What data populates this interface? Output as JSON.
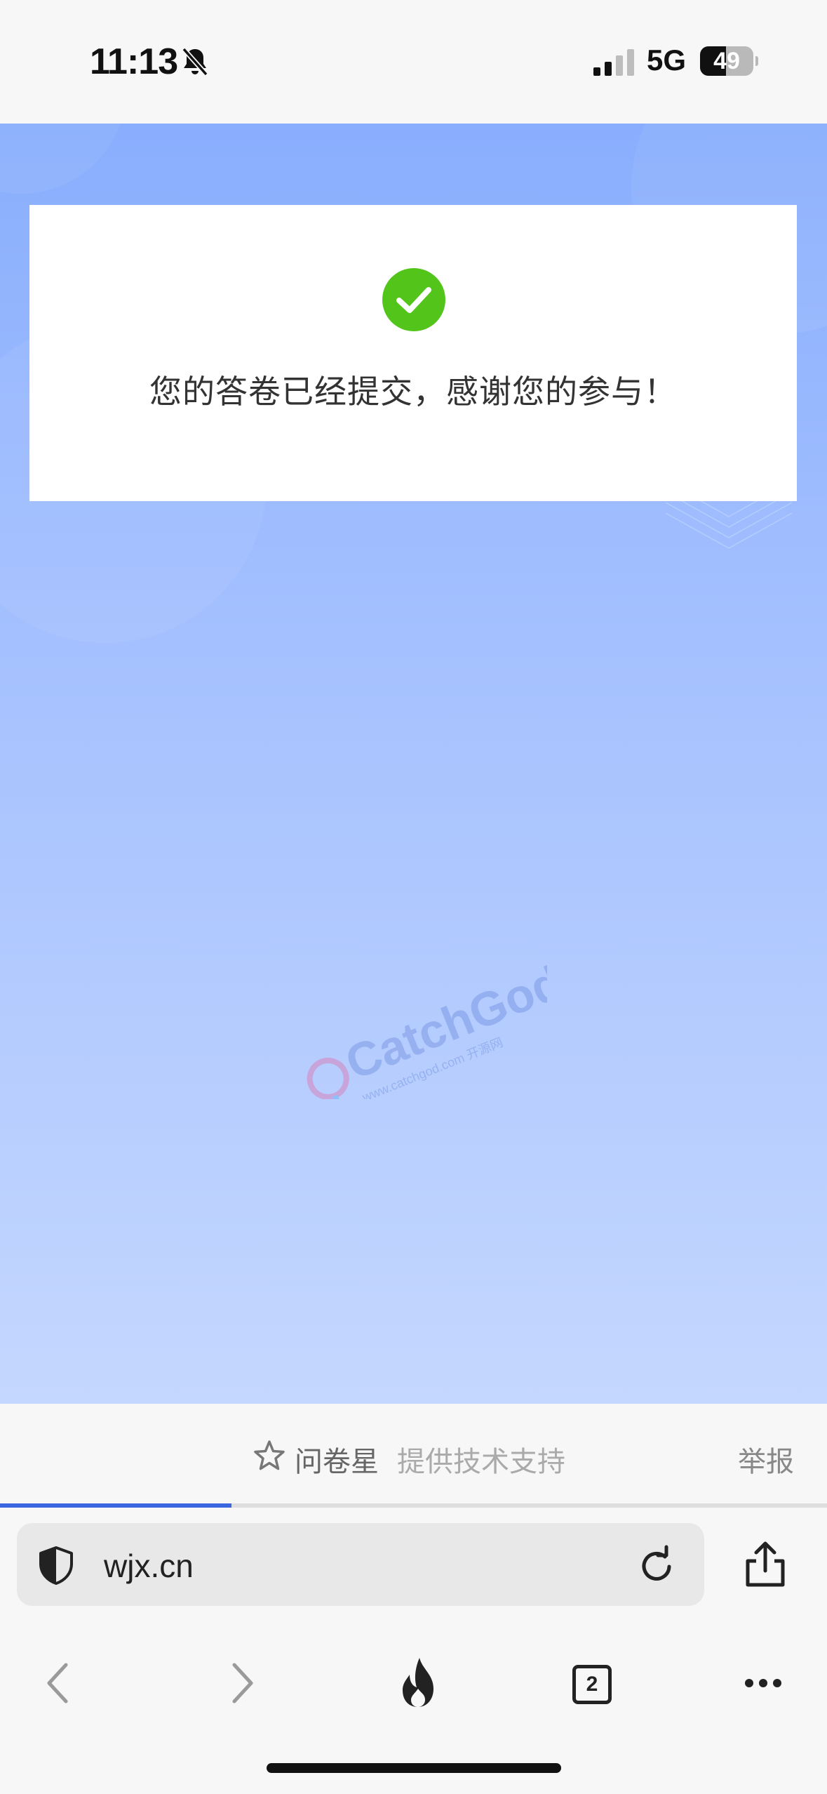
{
  "status_bar": {
    "time": "11:13",
    "network": "5G",
    "battery_level": "49",
    "battery_fraction": 0.49
  },
  "page": {
    "message": "您的答卷已经提交，感谢您的参与！",
    "check_color": "#52c41a",
    "watermark_logo": "CatchGod",
    "watermark_url": "www.catchgod.com 开源网"
  },
  "footer": {
    "brand": "问卷星",
    "support": "提供技术支持",
    "report": "举报"
  },
  "browser": {
    "url": "wjx.cn",
    "tab_count": "2",
    "load_progress": 0.28
  },
  "icons": {
    "bell": "bell-slash-icon",
    "signal": "cellular-signal-icon",
    "check": "check-circle-icon",
    "star": "star-outline-icon",
    "shield": "shield-icon",
    "reload": "reload-icon",
    "share": "share-icon",
    "back": "chevron-left-icon",
    "forward": "chevron-right-icon",
    "hot": "flame-icon",
    "more": "more-dots-icon"
  }
}
